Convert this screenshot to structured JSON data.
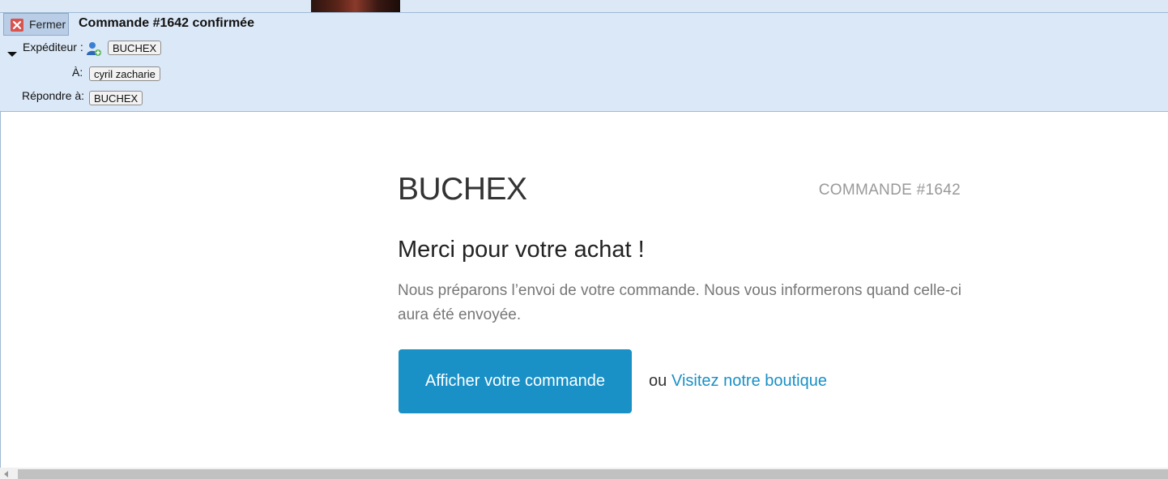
{
  "header": {
    "close_label": "Fermer",
    "subject": "Commande #1642 confirmée",
    "from_label": "Expéditeur :",
    "from_value": "BUCHEX",
    "to_label": "À:",
    "to_value": "cyril zacharie",
    "reply_label": "Répondre à:",
    "reply_value": "BUCHEX"
  },
  "email": {
    "brand": "BUCHEX",
    "order_number": "COMMANDE #1642",
    "thanks": "Merci pour votre achat !",
    "description": "Nous préparons l’envoi de votre commande. Nous vous informerons quand celle-ci aura été envoyée.",
    "cta_label": "Afficher votre commande",
    "or_text": "ou",
    "shop_link": "Visitez notre boutique"
  },
  "colors": {
    "accent": "#1990c6",
    "header_bg": "#dbe8f7"
  },
  "icons": [
    "close-icon",
    "toggle-caret-icon",
    "contact-icon",
    "scroll-left-arrow-icon"
  ]
}
